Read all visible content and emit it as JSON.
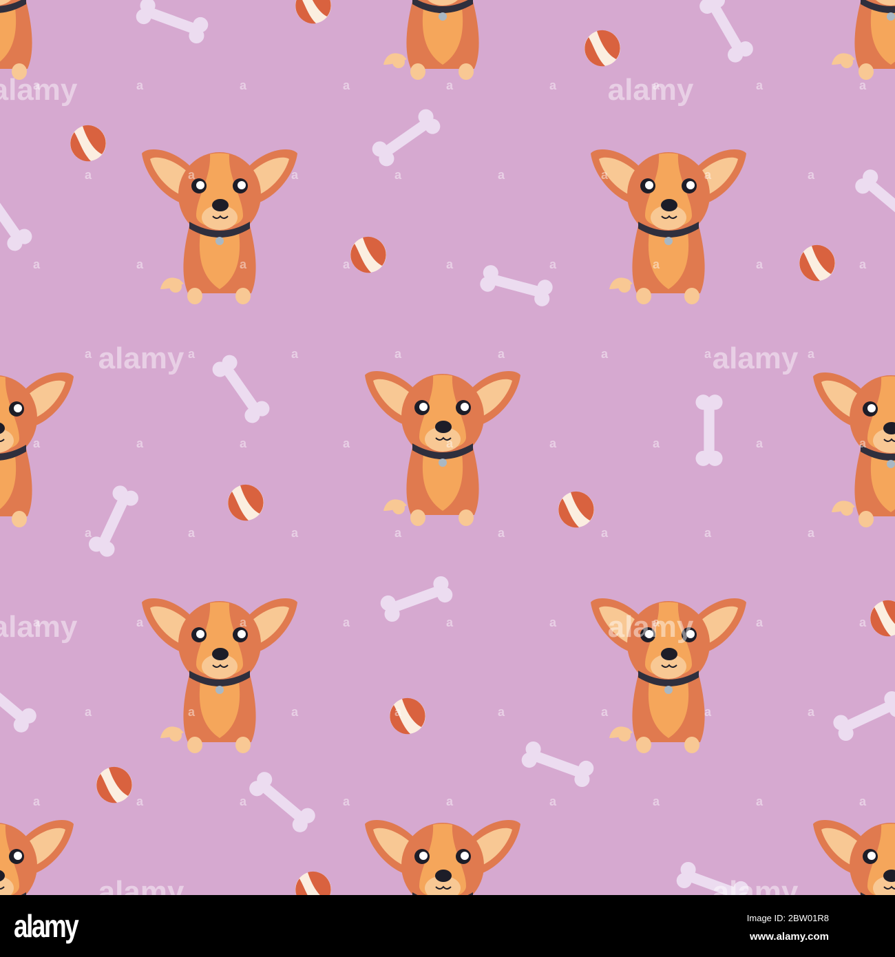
{
  "watermark": {
    "text": "alamy",
    "mark": "a"
  },
  "footer": {
    "logo": "alamy",
    "image_id": "Image ID: 2BW01R8",
    "website": "www.alamy.com"
  },
  "colors": {
    "background": "#d6a9d0",
    "bone": "#ecdcf0",
    "dog_dark": "#e07a4f",
    "dog_light": "#f5a65b",
    "dog_pale": "#f8c894",
    "collar": "#2f2f3d",
    "ball_red": "#d9623f",
    "ball_cream": "#fbeee0"
  }
}
